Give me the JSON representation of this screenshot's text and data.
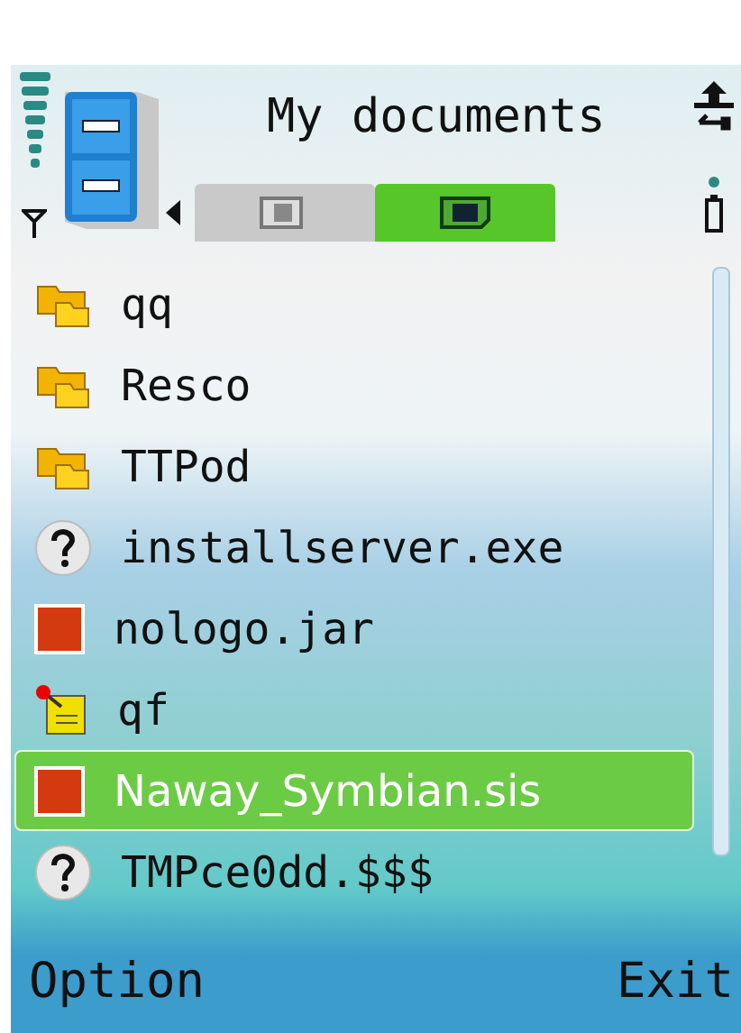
{
  "header": {
    "title": "My documents"
  },
  "tabs": [
    {
      "kind": "phone",
      "selected": false
    },
    {
      "kind": "card",
      "selected": true
    }
  ],
  "items": [
    {
      "kind": "folder",
      "name": "qq",
      "selected": false
    },
    {
      "kind": "folder",
      "name": "Resco",
      "selected": false
    },
    {
      "kind": "folder",
      "name": "TTPod",
      "selected": false
    },
    {
      "kind": "unknown",
      "name": "installserver.exe",
      "selected": false
    },
    {
      "kind": "app",
      "name": "nologo.jar",
      "selected": false
    },
    {
      "kind": "note",
      "name": "qf",
      "selected": false
    },
    {
      "kind": "app",
      "name": "Naway_Symbian.sis",
      "selected": true
    },
    {
      "kind": "unknown",
      "name": "TMPce0dd.$$$",
      "selected": false
    }
  ],
  "softkeys": {
    "left": "Option",
    "right": "Exit"
  }
}
